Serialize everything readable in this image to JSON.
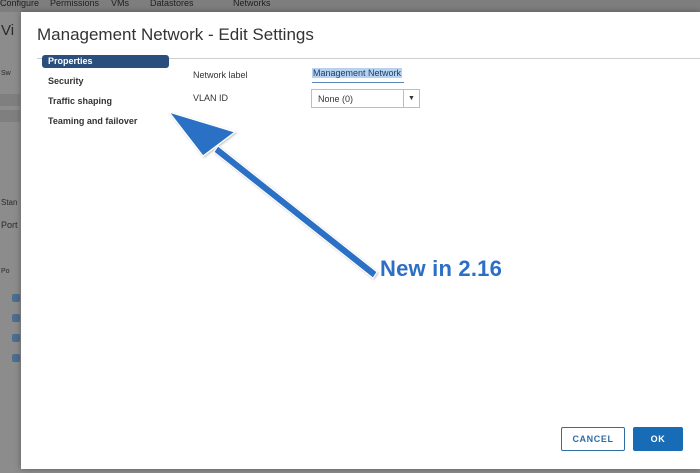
{
  "background": {
    "tabs": [
      "Configure",
      "Permissions",
      "VMs",
      "Datastores",
      "Networks"
    ],
    "left_fragments": [
      "Vi",
      "Sw",
      "Stan",
      "Port",
      "Po"
    ]
  },
  "dialog": {
    "title": "Management Network - Edit Settings",
    "nav": [
      "Properties",
      "Security",
      "Traffic shaping",
      "Teaming and failover"
    ],
    "active_nav": "Properties",
    "network_label": {
      "label": "Network label",
      "value": "Management Network"
    },
    "vlan": {
      "label": "VLAN ID",
      "value": "None (0)"
    },
    "buttons": {
      "cancel": "CANCEL",
      "ok": "OK"
    }
  },
  "annotation": {
    "text": "New in 2.16",
    "color": "#2c6fc4"
  },
  "colors": {
    "accent": "#176cb5",
    "nav_active": "#2a4f7d"
  }
}
